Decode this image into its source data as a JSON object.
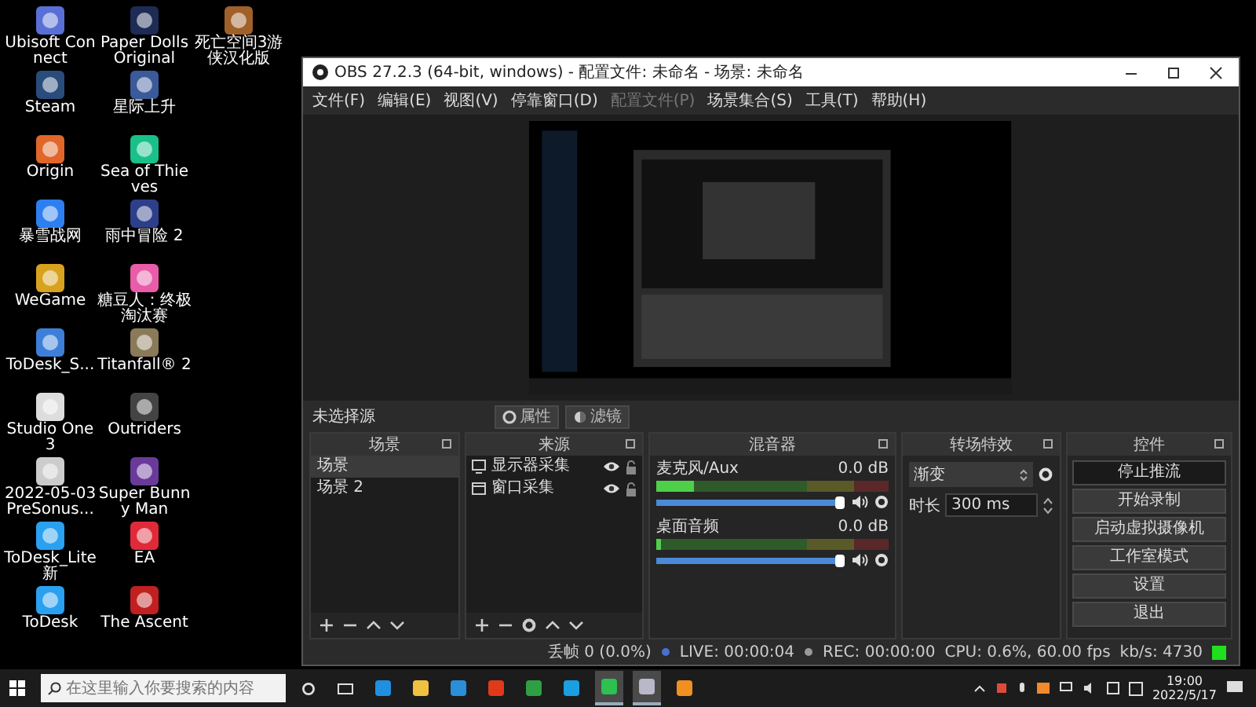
{
  "desktop": {
    "icons": [
      {
        "label": "Ubisoft Connect"
      },
      {
        "label": "Steam"
      },
      {
        "label": "Origin"
      },
      {
        "label": "暴雪战网"
      },
      {
        "label": "WeGame"
      },
      {
        "label": "ToDesk_S..."
      },
      {
        "label": "Studio One 3"
      },
      {
        "label": "2022-05-03 PreSonus..."
      },
      {
        "label": "ToDesk_Lite 新"
      },
      {
        "label": "ToDesk"
      },
      {
        "label": "Paper Dolls Original"
      },
      {
        "label": "星际上升"
      },
      {
        "label": "Sea of Thieves"
      },
      {
        "label": "雨中冒险 2"
      },
      {
        "label": "糖豆人：终极淘汰赛"
      },
      {
        "label": "Titanfall® 2"
      },
      {
        "label": "Outriders"
      },
      {
        "label": "Super Bunny Man"
      },
      {
        "label": "EA"
      },
      {
        "label": "The Ascent"
      },
      {
        "label": "死亡空间3游侠汉化版"
      }
    ]
  },
  "obs": {
    "title": "OBS 27.2.3 (64-bit, windows) - 配置文件: 未命名 - 场景: 未命名",
    "menu": [
      {
        "label": "文件(F)",
        "disabled": false
      },
      {
        "label": "编辑(E)",
        "disabled": false
      },
      {
        "label": "视图(V)",
        "disabled": false
      },
      {
        "label": "停靠窗口(D)",
        "disabled": false
      },
      {
        "label": "配置文件(P)",
        "disabled": true
      },
      {
        "label": "场景集合(S)",
        "disabled": false
      },
      {
        "label": "工具(T)",
        "disabled": false
      },
      {
        "label": "帮助(H)",
        "disabled": false
      }
    ],
    "source_toolbar": {
      "label": "未选择源",
      "buttons": [
        "属性",
        "滤镜"
      ]
    },
    "scenes": {
      "title": "场景",
      "items": [
        {
          "name": "场景",
          "selected": true
        },
        {
          "name": "场景 2",
          "selected": false
        }
      ]
    },
    "sources": {
      "title": "来源",
      "items": [
        {
          "name": "显示器采集",
          "kind": "monitor",
          "visible": true,
          "locked": false
        },
        {
          "name": "窗口采集",
          "kind": "window",
          "visible": true,
          "locked": false
        }
      ]
    },
    "mixer": {
      "title": "混音器",
      "channels": [
        {
          "name": "麦克风/Aux",
          "reading": "0.0 dB",
          "meter": {
            "level": 0.16
          },
          "volume": {
            "level": 1
          },
          "muted": false
        },
        {
          "name": "桌面音频",
          "reading": "0.0 dB",
          "meter": {
            "level": 0.02
          },
          "volume": {
            "level": 1
          },
          "muted": false
        }
      ]
    },
    "transitions": {
      "title": "转场特效",
      "selected": "渐变",
      "duration_label": "时长",
      "duration": "300 ms"
    },
    "controls": {
      "title": "控件",
      "buttons": [
        {
          "label": "停止推流",
          "active": true
        },
        {
          "label": "开始录制",
          "active": false
        },
        {
          "label": "启动虚拟摄像机",
          "active": false
        },
        {
          "label": "工作室模式",
          "active": false
        },
        {
          "label": "设置",
          "active": false
        },
        {
          "label": "退出",
          "active": false
        }
      ]
    },
    "status_bar": [
      "丢帧 0 (0.0%)",
      "LIVE: 00:00:04",
      "REC: 00:00:00",
      "CPU: 0.6%, 60.00 fps",
      "kb/s: 4730"
    ]
  },
  "taskbar": {
    "search": {
      "placeholder": "在这里输入你要搜索的内容"
    },
    "apps": [
      {
        "active": false
      },
      {
        "active": false
      },
      {
        "active": false
      },
      {
        "active": false
      },
      {
        "active": false
      },
      {
        "active": false
      },
      {
        "active": true
      },
      {
        "active": true
      },
      {
        "active": false
      }
    ],
    "clock": {
      "time": "19:00",
      "date": "2022/5/17"
    }
  }
}
